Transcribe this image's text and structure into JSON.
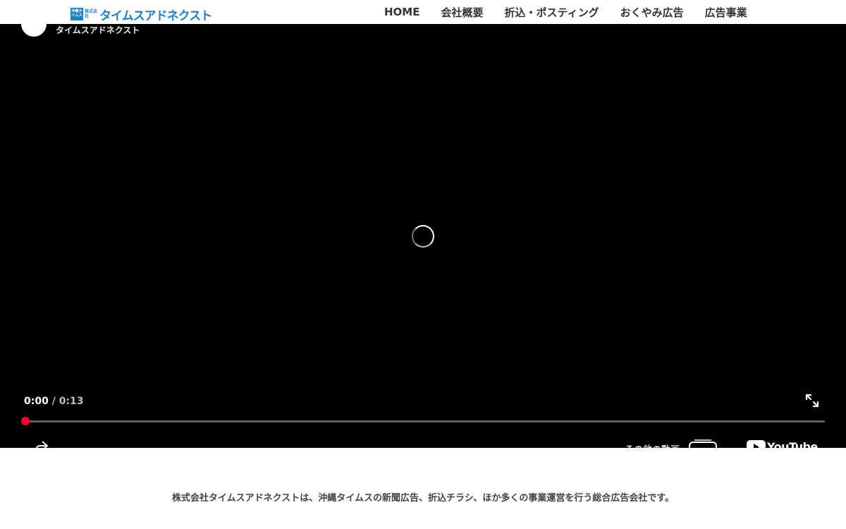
{
  "header": {
    "logo_box": "沖縄タイムス",
    "logo_small": "株式会社",
    "logo_text": "タイムスアドネクスト",
    "nav": [
      "HOME",
      "会社概要",
      "折込・ポスティング",
      "おくやみ広告",
      "広告事業"
    ]
  },
  "player": {
    "channel_name": "タイムスアドネクスト",
    "current_time": "0:00",
    "separator": " / ",
    "duration": "0:13",
    "progress": 0,
    "more_videos_label": "その他の動画",
    "youtube_label": "YouTube",
    "icons": [
      "share-icon",
      "fullscreen-icon",
      "loading-spinner",
      "more-videos-icon",
      "youtube-logo"
    ]
  },
  "tagline": "株式会社タイムスアドネクストは、沖縄タイムスの新聞広告、折込チラシ、ほか多くの事業運営を行う総合広告会社です。",
  "colors": {
    "brand_blue": "#1b7fc2",
    "progress_red": "#ff0033",
    "player_bg": "#000000"
  }
}
